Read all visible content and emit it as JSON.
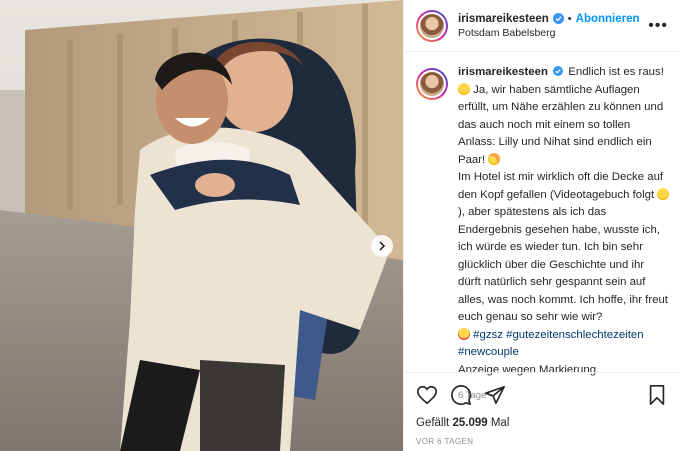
{
  "post": {
    "username": "irismareikesteen",
    "follow_label": "Abonnieren",
    "location": "Potsdam Babelsberg",
    "more_label": "•••"
  },
  "caption": {
    "username": "irismareikesteen",
    "p1": "Endlich ist es raus!",
    "p2": "Ja, wir haben sämtliche Auflagen erfüllt, um Nähe erzählen zu können und das auch noch mit einem so tollen Anlass: Lilly und Nihat sind endlich ein Paar!",
    "p3a": "Im Hotel ist mir wirklich oft die Decke auf den Kopf gefallen (Videotagebuch folgt",
    "p3b": "), aber spätestens als ich das Endergebnis gesehen habe, wusste ich, ich würde es wieder tun. Ich bin sehr glücklich über die Geschichte und ihr dürft natürlich sehr gespannt sein auf alles, was noch kommt. Ich hoffe, ihr freut euch genau so sehr wie wir?",
    "tags": [
      "#gzsz",
      "#gutezeitenschlechtezeiten",
      "#newcouple"
    ],
    "notice": "Anzeige wegen Markierung.",
    "time": "6 Tage"
  },
  "actions": {
    "likes_prefix": "Gefällt",
    "likes_count": "25.099",
    "likes_suffix": "Mal",
    "ago": "VOR 6 TAGEN"
  },
  "icons": [
    "heart-icon",
    "comment-icon",
    "share-icon",
    "bookmark-icon",
    "verified-icon",
    "chevron-right-icon"
  ],
  "colors": {
    "link": "#0095f6",
    "hashtag": "#00376b",
    "muted": "#8e8e8e"
  }
}
